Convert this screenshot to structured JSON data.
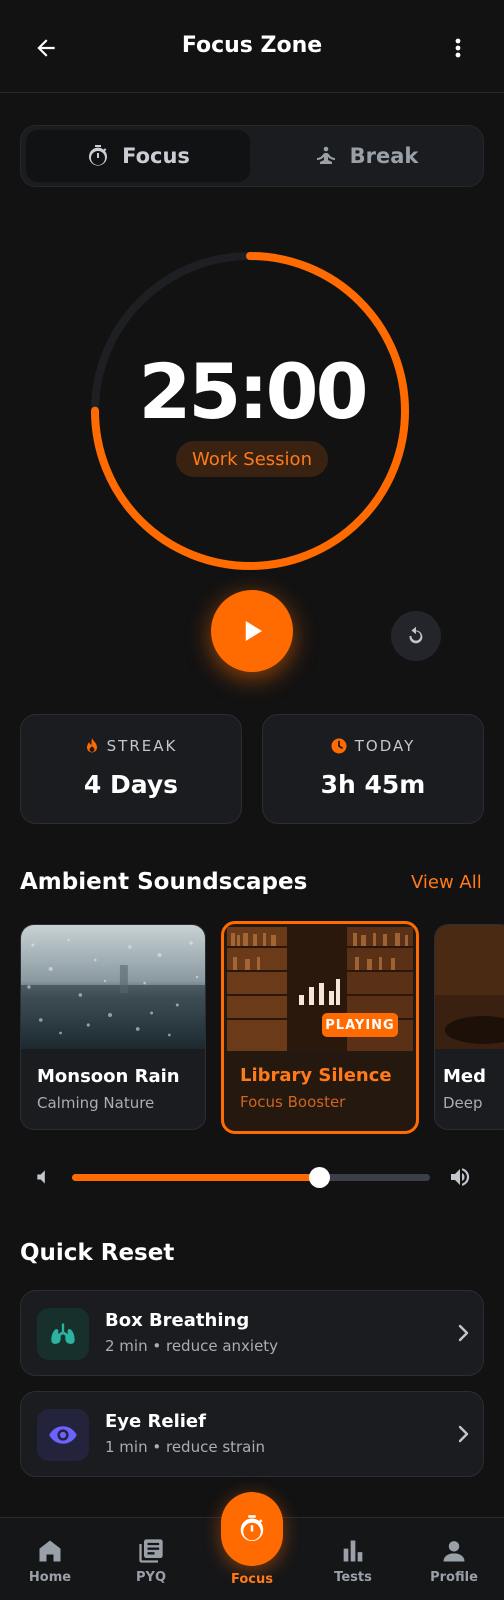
{
  "header": {
    "title": "Focus Zone"
  },
  "mode_toggle": {
    "focus_label": "Focus",
    "break_label": "Break",
    "selected": "Focus"
  },
  "timer": {
    "time": "25:00",
    "session_label": "Work Session",
    "progress": 0.75
  },
  "stats": {
    "streak": {
      "label": "STREAK",
      "value": "4 Days"
    },
    "today": {
      "label": "TODAY",
      "value": "3h 45m"
    }
  },
  "soundscapes": {
    "title": "Ambient Soundscapes",
    "view_all": "View All",
    "items": [
      {
        "title": "Monsoon Rain",
        "subtitle": "Calming Nature"
      },
      {
        "title": "Library Silence",
        "subtitle": "Focus Booster",
        "badge": "PLAYING"
      },
      {
        "title": "Med",
        "subtitle": "Deep"
      }
    ]
  },
  "volume": {
    "level": 0.69
  },
  "quick_reset": {
    "title": "Quick Reset",
    "items": [
      {
        "title": "Box Breathing",
        "subtitle": "2 min • reduce anxiety",
        "icon": "lungs-icon"
      },
      {
        "title": "Eye Relief",
        "subtitle": "1 min • reduce strain",
        "icon": "eye-icon"
      }
    ]
  },
  "nav": {
    "items": [
      {
        "label": "Home"
      },
      {
        "label": "PYQ"
      },
      {
        "label": "Focus"
      },
      {
        "label": "Tests"
      },
      {
        "label": "Profile"
      }
    ],
    "active": "Focus"
  },
  "colors": {
    "accent": "#ff6b00",
    "background": "#121212",
    "card": "#1b1c1f"
  }
}
